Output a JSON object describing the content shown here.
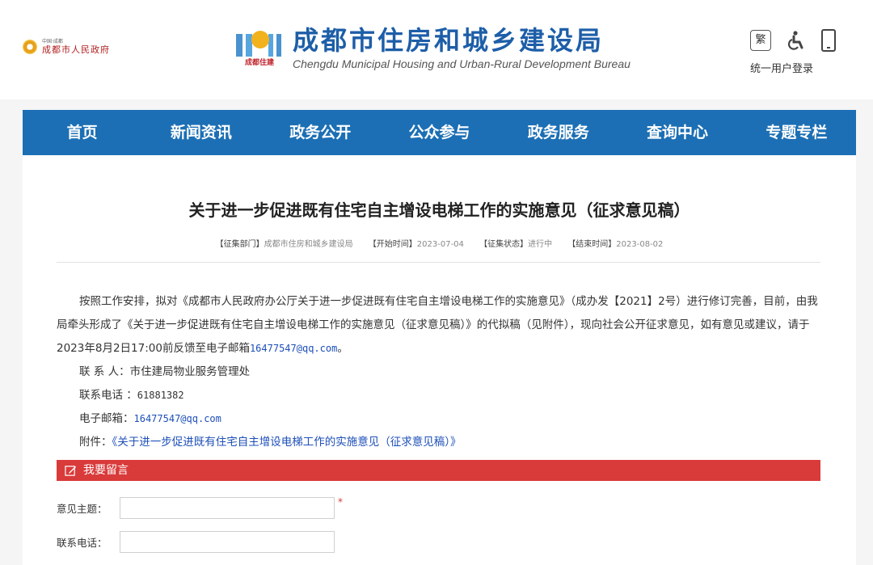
{
  "header": {
    "gov_small": "中国·成都",
    "gov_name": "成都市人民政府",
    "brand_logo_label": "成都住建",
    "brand_title": "成都市住房和城乡建设局",
    "brand_subtitle": "Chengdu Municipal Housing and Urban-Rural Development Bureau",
    "traditional_label": "繁",
    "login_label": "统一用户登录"
  },
  "nav": {
    "items": [
      "首页",
      "新闻资讯",
      "政务公开",
      "公众参与",
      "政务服务",
      "查询中心",
      "专题专栏"
    ]
  },
  "article": {
    "title": "关于进一步促进既有住宅自主增设电梯工作的实施意见（征求意见稿）",
    "meta": {
      "dept_label": "【征集部门】",
      "dept_value": "成都市住房和城乡建设局",
      "start_label": "【开始时间】",
      "start_value": "2023-07-04",
      "status_label": "【征集状态】",
      "status_value": "进行中",
      "end_label": "【结束时间】",
      "end_value": "2023-08-02"
    },
    "para1": "按照工作安排，拟对《成都市人民政府办公厅关于进一步促进既有住宅自主增设电梯工作的实施意见》（成办发【2021】2号）进行修订完善，目前，由我局牵头形成了《关于进一步促进既有住宅自主增设电梯工作的实施意见（征求意见稿）》的代拟稿（见附件），现向社会公开征求意见，如有意见或建议，请于2023年8月2日17:00前反馈至电子邮箱",
    "para1_email": "16477547@qq.com",
    "para1_end": "。",
    "contact_label": "联 系 人：",
    "contact_value": "市住建局物业服务管理处",
    "phone_label": "联系电话 ：",
    "phone_value": "61881382",
    "email_label": "电子邮箱：",
    "email_value": "16477547@qq.com",
    "attach_label": "附件：",
    "attach_link": "《关于进一步促进既有住宅自主增设电梯工作的实施意见（征求意见稿）》"
  },
  "message": {
    "bar_title": "我要留言",
    "subject_label": "意见主题：",
    "required_mark": "*",
    "phone_label": "联系电话："
  },
  "colors": {
    "nav_bg": "#1c6fb4",
    "brand_blue": "#1d5ea8",
    "message_bar": "#d93a3a",
    "link": "#1d4fb8"
  }
}
